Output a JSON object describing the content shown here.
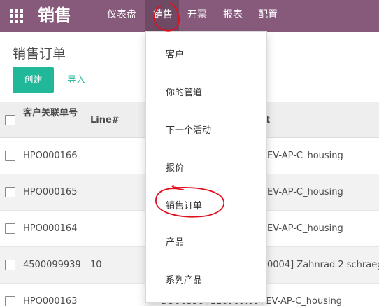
{
  "app": {
    "title": "销售",
    "nav": [
      "仪表盘",
      "销售",
      "开票",
      "报表",
      "配置"
    ]
  },
  "page": {
    "title": "销售订单",
    "create_label": "创建",
    "import_label": "导入"
  },
  "table": {
    "headers": {
      "customer_ref": "客户关联单号",
      "line": "Line#",
      "product_partial": "t"
    },
    "rows": [
      {
        "customer_ref": "HPO000166",
        "line": "",
        "product": "EV-AP-C_housing"
      },
      {
        "customer_ref": "HPO000165",
        "line": "",
        "product": "EV-AP-C_housing"
      },
      {
        "customer_ref": "HPO000164",
        "line": "",
        "product": "EV-AP-C_housing"
      },
      {
        "customer_ref": "4500099939",
        "line": "10",
        "product": "0004] Zahnrad 2 schraeg"
      },
      {
        "customer_ref": "HPO000163",
        "line": "",
        "product": "DSO0350  [110909.09] EV-AP-C_housing"
      }
    ]
  },
  "menu": {
    "items": [
      "客户",
      "你的管道",
      "下一个活动",
      "报价",
      "销售订单",
      "产品",
      "系列产品"
    ]
  },
  "colors": {
    "topbar": "#875a7b",
    "topbar_active": "#6e4a64",
    "primary": "#21b799",
    "annotation": "#e0101e"
  }
}
